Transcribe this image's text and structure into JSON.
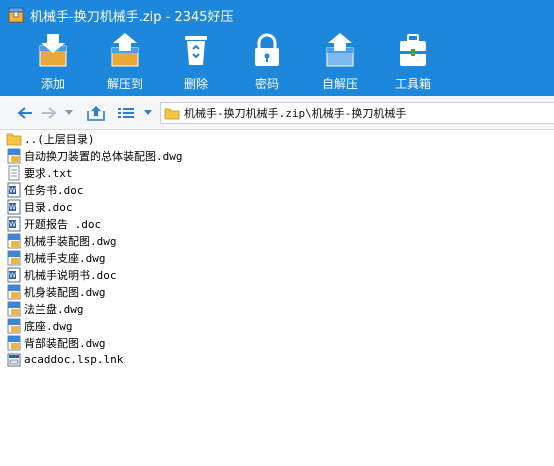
{
  "window": {
    "title": "机械手-换刀机械手.zip - 2345好压"
  },
  "toolbar": {
    "items": [
      {
        "label": "添加",
        "icon": "add-archive-icon"
      },
      {
        "label": "解压到",
        "icon": "extract-to-icon"
      },
      {
        "label": "删除",
        "icon": "recycle-bin-icon"
      },
      {
        "label": "密码",
        "icon": "padlock-icon"
      },
      {
        "label": "自解压",
        "icon": "self-extract-icon"
      },
      {
        "label": "工具箱",
        "icon": "toolbox-icon"
      }
    ]
  },
  "nav": {
    "address": "机械手-换刀机械手.zip\\机械手-换刀机械手"
  },
  "files": [
    {
      "name": "..(上层目录)",
      "type": "folder"
    },
    {
      "name": "自动换刀装置的总体装配图.dwg",
      "type": "dwg"
    },
    {
      "name": "要求.txt",
      "type": "txt"
    },
    {
      "name": "任务书.doc",
      "type": "doc"
    },
    {
      "name": "目录.doc",
      "type": "doc"
    },
    {
      "name": "开题报告 .doc",
      "type": "doc"
    },
    {
      "name": "机械手装配图.dwg",
      "type": "dwg"
    },
    {
      "name": "机械手支座.dwg",
      "type": "dwg"
    },
    {
      "name": "机械手说明书.doc",
      "type": "doc"
    },
    {
      "name": "机身装配图.dwg",
      "type": "dwg"
    },
    {
      "name": "法兰盘.dwg",
      "type": "dwg"
    },
    {
      "name": "底座.dwg",
      "type": "dwg"
    },
    {
      "name": "背部装配图.dwg",
      "type": "dwg"
    },
    {
      "name": "acaddoc.lsp.lnk",
      "type": "lnk"
    }
  ],
  "colors": {
    "accent": "#1c87db",
    "nav_bg": "#f4f6f9",
    "folder": "#f5c542"
  }
}
